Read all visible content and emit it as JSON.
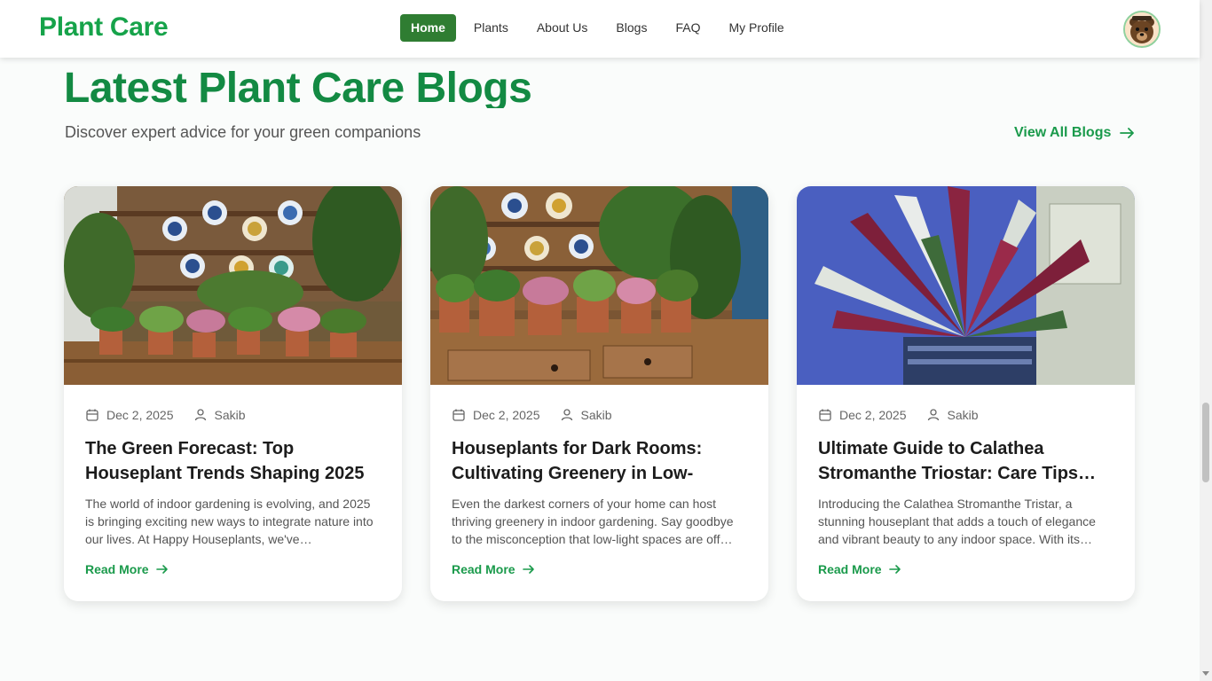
{
  "header": {
    "logo": "Plant Care",
    "nav": [
      "Home",
      "Plants",
      "About Us",
      "Blogs",
      "FAQ",
      "My Profile"
    ],
    "active_nav": "Home",
    "avatar_icon": "bear-avatar-icon"
  },
  "section": {
    "title": "Latest Plant Care Blogs",
    "subtitle": "Discover expert advice for your green companions",
    "view_all": "View All Blogs"
  },
  "colors": {
    "brand_green": "#16a34a",
    "active_nav_bg": "#2f7d32",
    "link_green": "#1a9a4b"
  },
  "cards": [
    {
      "date": "Dec 2, 2025",
      "author": "Sakib",
      "title": "The Green Forecast: Top Houseplant Trends Shaping 2025",
      "excerpt": "The world of indoor gardening is evolving, and 2025 is bringing exciting new ways to integrate nature into our lives. At Happy Houseplants, we've…",
      "read_more": "Read More",
      "image": "plants-on-dresser-photo"
    },
    {
      "date": "Dec 2, 2025",
      "author": "Sakib",
      "title": "Houseplants for Dark Rooms: Cultivating Greenery in Low-Ligh…",
      "excerpt": "Even the darkest corners of your home can host thriving greenery in indoor gardening. Say goodbye to the misconception that low-light spaces are off…",
      "read_more": "Read More",
      "image": "potted-plants-wooden-cabinet-photo"
    },
    {
      "date": "Dec 2, 2025",
      "author": "Sakib",
      "title": "Ultimate Guide to Calathea Stromanthe Triostar: Care Tips…",
      "excerpt": "Introducing the Calathea Stromanthe Tristar, a stunning houseplant that adds a touch of elegance and vibrant beauty to any indoor space. With its…",
      "read_more": "Read More",
      "image": "calathea-stromanthe-photo"
    }
  ]
}
